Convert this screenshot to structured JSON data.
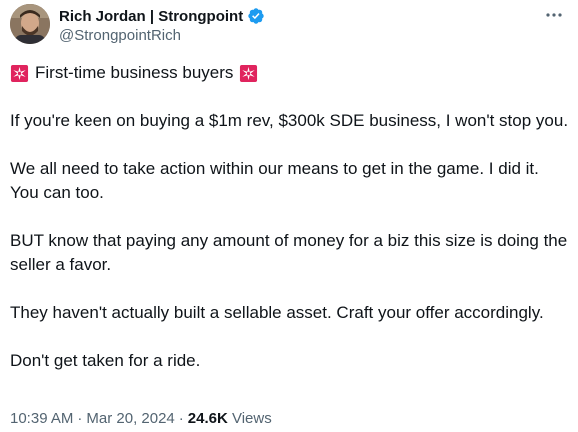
{
  "author": {
    "display_name": "Rich Jordan | Strongpoint",
    "handle": "@StrongpointRich",
    "verified": true,
    "avatar_icon": "user-avatar-photo"
  },
  "accent_color": "#1d9bf0",
  "siren_color": "#e0245e",
  "tweet": {
    "headline": "First-time business buyers",
    "paragraphs": [
      "If you're keen on buying a $1m rev, $300k SDE business, I won't stop you.",
      "We all need to take action within our means to get in the game. I did it. You can too.",
      "BUT know that paying any amount of money for a biz this size is doing the seller a favor.",
      "They haven't actually built a sellable asset. Craft your offer accordingly.",
      "Don't get taken for a ride."
    ]
  },
  "meta": {
    "time": "10:39 AM",
    "separator": "·",
    "date": "Mar 20, 2024",
    "views_count": "24.6K",
    "views_label": "Views"
  }
}
